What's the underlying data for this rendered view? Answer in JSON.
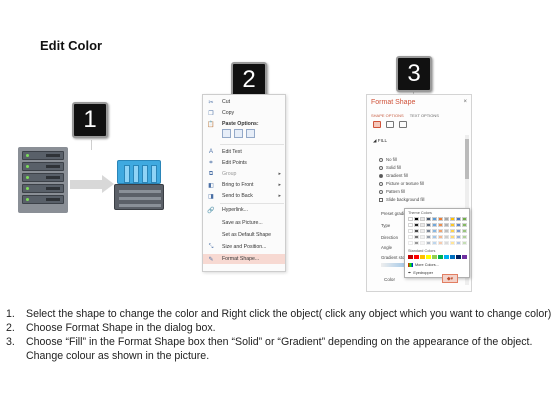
{
  "page_title": "Edit Color",
  "step_badges": [
    "1",
    "2",
    "3"
  ],
  "context_menu": {
    "items": [
      {
        "label": "Cut",
        "icon": "scissors-icon"
      },
      {
        "label": "Copy",
        "icon": "copy-icon"
      },
      {
        "label": "Paste Options:",
        "icon": "clipboard-icon",
        "bold": true
      },
      {
        "label": "Edit Text",
        "icon": "edit-text-icon"
      },
      {
        "label": "Edit Points",
        "icon": "edit-points-icon"
      },
      {
        "label": "Group",
        "icon": "group-icon",
        "submenu": true
      },
      {
        "label": "Bring to Front",
        "icon": "bring-front-icon",
        "submenu": true
      },
      {
        "label": "Send to Back",
        "icon": "send-back-icon",
        "submenu": true
      },
      {
        "label": "Hyperlink...",
        "icon": "hyperlink-icon"
      },
      {
        "label": "Save as Picture...",
        "icon": ""
      },
      {
        "label": "Set as Default Shape",
        "icon": ""
      },
      {
        "label": "Size and Position...",
        "icon": "size-position-icon"
      },
      {
        "label": "Format Shape...",
        "icon": "format-shape-icon",
        "highlighted": true
      }
    ]
  },
  "format_panel": {
    "title": "Format Shape",
    "close": "×",
    "tabs": [
      "SHAPE OPTIONS",
      "TEXT OPTIONS"
    ],
    "fill_header": "◢ FILL",
    "fill_options": [
      {
        "label": "No fill",
        "selected": false
      },
      {
        "label": "Solid fill",
        "selected": false
      },
      {
        "label": "Gradient fill",
        "selected": true
      },
      {
        "label": "Picture or texture fill",
        "selected": false
      },
      {
        "label": "Pattern fill",
        "selected": false
      }
    ],
    "checkbox_label": "Slide background fill",
    "rows": [
      "Preset gradi",
      "Type",
      "Direction",
      "Angle",
      "Gradient sto"
    ],
    "color_label": "Color",
    "palette": {
      "theme_header": "Theme Colors",
      "standard_header": "Standard Colors",
      "more_colors": "More Colors...",
      "eyedropper": "Eyedropper"
    },
    "theme_colors": [
      "#ffffff",
      "#000000",
      "#e7e6e6",
      "#44546a",
      "#5b9bd5",
      "#ed7d31",
      "#a5a5a5",
      "#ffc000",
      "#4472c4",
      "#70ad47"
    ],
    "standard_colors": [
      "#c00000",
      "#ff0000",
      "#ffc000",
      "#ffff00",
      "#92d050",
      "#00b050",
      "#00b0f0",
      "#0070c0",
      "#002060",
      "#7030a0"
    ]
  },
  "instructions": [
    {
      "num": "1.",
      "text": "Select the shape to change the color and Right click the object( click any object which you want to change color)"
    },
    {
      "num": "2.",
      "text": "Choose Format Shape in the dialog box."
    },
    {
      "num": "3.",
      "text": "Choose “Fill” in the Format Shape box then “Solid” or “Gradient” depending on the appearance of the object. Change colour as shown in the picture."
    }
  ]
}
